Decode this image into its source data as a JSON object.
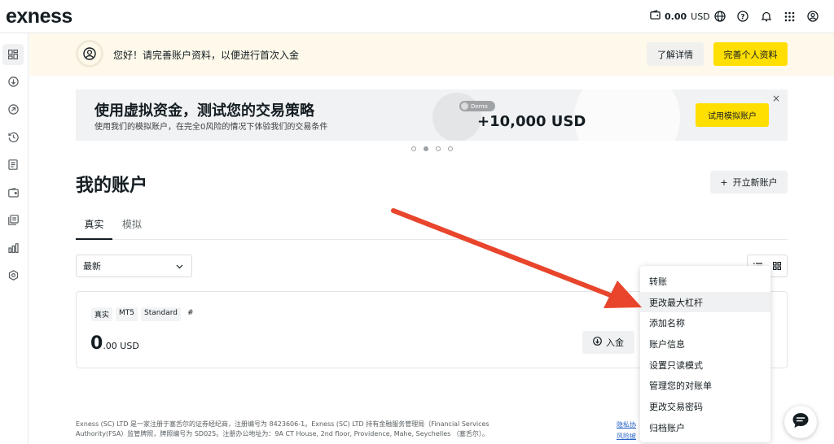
{
  "header": {
    "logo": "exness",
    "balance_amount": "0.00",
    "balance_currency": "USD",
    "icons": [
      "wallet-icon",
      "globe-icon",
      "help-icon",
      "bell-icon",
      "apps-grid-icon",
      "profile-icon"
    ]
  },
  "sidebar": {
    "items": [
      {
        "icon": "dashboard-icon"
      },
      {
        "icon": "deposit-icon"
      },
      {
        "icon": "withdraw-icon"
      },
      {
        "icon": "history-icon"
      },
      {
        "icon": "reports-icon"
      },
      {
        "icon": "wallet-icon"
      },
      {
        "icon": "copy-trading-icon"
      },
      {
        "icon": "analytics-icon"
      },
      {
        "icon": "settings-icon"
      }
    ]
  },
  "notice": {
    "text": "您好！请完善账户资料，以便进行首次入金",
    "learn_more": "了解详情",
    "complete_profile": "完善个人资料"
  },
  "banner": {
    "title": "使用虚拟资金，测试您的交易策略",
    "subtitle": "使用我们的模拟账户，在完全0风险的情况下体验我们的交易条件",
    "toggle_label": "Demo",
    "amount": "+10,000 USD",
    "cta": "试用模拟账户",
    "close": "×",
    "slide_count": 4,
    "active_slide": 2
  },
  "accounts": {
    "title": "我的账户",
    "new_account": "开立新账户",
    "tabs": [
      {
        "label": "真实",
        "active": true
      },
      {
        "label": "模拟",
        "active": false
      }
    ],
    "sort_value": "最新",
    "card": {
      "tags": [
        "真实",
        "MT5",
        "Standard",
        "#"
      ],
      "balance_main": "0",
      "balance_rest": ".00 USD",
      "deposit": "入金"
    }
  },
  "context_menu": {
    "items": [
      "转账",
      "更改最大杠杆",
      "添加名称",
      "账户信息",
      "设置只读模式",
      "管理您的对账单",
      "更改交易密码",
      "归档账户"
    ],
    "highlighted_index": 1
  },
  "footer": {
    "legal": "Exness (SC) LTD 是一家注册于塞舌尔的证券经纪商，注册编号为 8423606-1。Exness (SC) LTD 持有金融服务管理局（Financial Services Authority(FSA）监管牌照，牌照编号为 SD025。注册办公地址为：9A CT House, 2nd floor, Providence, Mahe, Seychelles （塞舌尔）。",
    "links": [
      "隐私协",
      "风险披"
    ]
  },
  "colors": {
    "accent_yellow": "#ffde02",
    "notice_bg": "#fef9ea",
    "annotation_arrow": "#e8452c"
  }
}
